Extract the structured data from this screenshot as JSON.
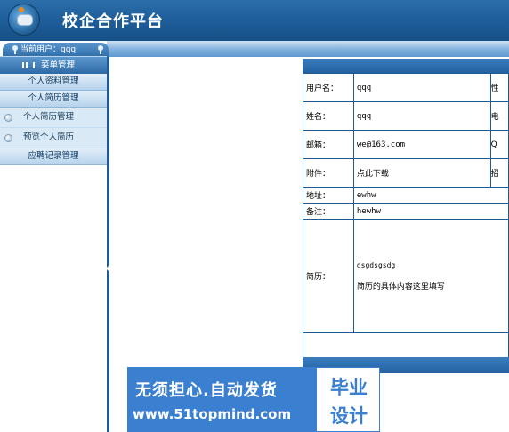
{
  "app": {
    "title": "校企合作平台"
  },
  "sidebar": {
    "user_label": "当前用户：qqq",
    "menu_header": "菜单管理",
    "sections": [
      {
        "label": "个人资料管理"
      },
      {
        "label": "个人简历管理"
      }
    ],
    "items": [
      {
        "label": "个人简历管理"
      },
      {
        "label": "预览个人简历"
      }
    ],
    "footer_section": {
      "label": "应聘记录管理"
    }
  },
  "resume": {
    "rows": [
      {
        "label": "用户名：",
        "value": "qqq",
        "extra": "性"
      },
      {
        "label": "姓名：",
        "value": "qqq",
        "extra": "电"
      },
      {
        "label": "邮箱：",
        "value": "we@163.com",
        "extra": "Q"
      },
      {
        "label": "附件：",
        "value": "点此下载",
        "extra": "招"
      },
      {
        "label": "地址：",
        "value": "ewhw"
      },
      {
        "label": "备注：",
        "value": "hewhw"
      }
    ],
    "resume_label": "简历：",
    "resume_lines": [
      "dsgdsgsdg",
      "简历的具体内容这里填写"
    ]
  },
  "watermark": {
    "line1": "无须担心.自动发货",
    "line2": "www.51topmind.com",
    "badge_top": "毕业",
    "badge_bottom": "设计"
  }
}
